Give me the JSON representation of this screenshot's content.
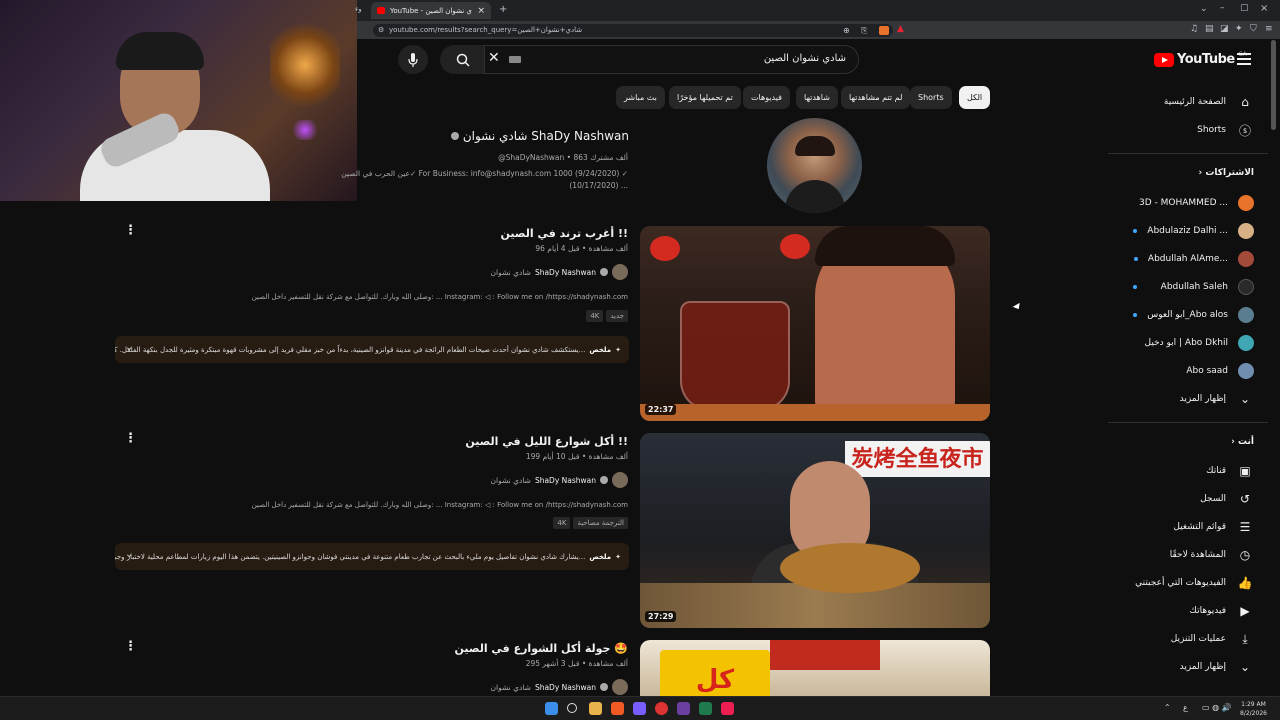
{
  "browser": {
    "tab_title": "YouTube - شادي نشوان الصين",
    "tab_side_label": "وء",
    "url": "youtube.com/results?search_query=شادي+نشوان+الصين",
    "new_tab": "+",
    "tab_close": "×",
    "window_controls": [
      "⌄",
      "–",
      "▢",
      "×"
    ]
  },
  "masthead": {
    "logo_text": "YouTube",
    "logo_country": "SA",
    "search_value": "شادي نشوان الصين"
  },
  "chips": [
    "الكل",
    "Shorts",
    "لم تتم مشاهدتها",
    "شاهدتها",
    "فيديوهات",
    "تم تحميلها مؤخرًا",
    "بث مباشر"
  ],
  "nav": {
    "home": "الصفحة الرئيسية",
    "shorts": "Shorts",
    "subscriptions_title": "الاشتراكات",
    "subscriptions": [
      {
        "name": "3D - MOHAMMED ...",
        "color": "#e8742c"
      },
      {
        "name": "Abdulaziz Dalhi ...",
        "color": "#d6b188"
      },
      {
        "name": "Abdullah AlAme...",
        "color": "#a34a3a"
      },
      {
        "name": "Abdullah Saleh",
        "color": "#2a2a2a"
      },
      {
        "name": "ابو العوس_Abo alos",
        "color": "#5a7d8f"
      },
      {
        "name": "ابو دخيل | Abo Dkhil",
        "color": "#3fa6b3"
      },
      {
        "name": "Abo saad",
        "color": "#6f8eb0"
      }
    ],
    "show_more": "إظهار المزيد",
    "you_title": "أنت",
    "you_items": [
      {
        "label": "قناتك",
        "icon": "channel-icon"
      },
      {
        "label": "السجل",
        "icon": "history-icon"
      },
      {
        "label": "قوائم التشغيل",
        "icon": "playlists-icon"
      },
      {
        "label": "المشاهدة لاحقًا",
        "icon": "watch-later-icon"
      },
      {
        "label": "الفيديوهات التي أعجبتني",
        "icon": "like-icon"
      },
      {
        "label": "فيديوهاتك",
        "icon": "your-videos-icon"
      },
      {
        "label": "عمليات التنزيل",
        "icon": "download-icon"
      }
    ],
    "show_more_2": "إظهار المزيد"
  },
  "channel": {
    "name": "شادي نشوان ShaDy Nashwan",
    "handle_subs": "@ShaDyNashwan • 863 ألف مشترك",
    "desc_line1": "عين الحرب في الصين✓ For Business: info@shadynash.com 1000 (9/24/2020) ✓",
    "desc_line2": "(10/17/2020) ..."
  },
  "videos": [
    {
      "title": "أغرب ترند في الصين !!",
      "meta": "96 ألف مشاهدة • قبل 4 أيام",
      "channel_ar": "شادي نشوان",
      "channel_en": "ShaDy Nashwan",
      "desc": "وصلى الله وبارك. للتواصل مع شركة نقل للتسفير داخل الصين: ... Instagram: ◁ : Follow me on /https://shadynash.com",
      "badges": [
        "جديد",
        "4K"
      ],
      "summary_label": "ملخص",
      "summary_text": "يستكشف شادي نشوان أحدث صيحات الطعام الرائجة في مدينة قوانزو الصينية، بدءاً من خبز مقلي فريد إلى مشروبات قهوة مبتكرة ومثيرة للجدل بنكهة الفلفل. كتحب...",
      "duration": "22:37"
    },
    {
      "title": "أكل شوارع الليل في الصين !!",
      "meta": "199 ألف مشاهدة • قبل 10 أيام",
      "channel_ar": "شادي نشوان",
      "channel_en": "ShaDy Nashwan",
      "desc": "وصلى الله وبارك. للتواصل مع شركة نقل للتسفير داخل الصين: ... Instagram: ◁ : Follow me on /https://shadynash.com",
      "badges": [
        "الترجمة مصاحبة",
        "4K"
      ],
      "summary_label": "ملخص",
      "summary_text": "يشارك شادي نشوان تفاصيل يوم مليء بالبحث عن تجارب طعام متنوعة في مدينتي فوشان وجوانزو الصينيتين. يتضمن هذا اليوم زيارات لمطاعم محلية لاختبار وجبا...",
      "duration": "27:29",
      "sign": "炭烤全鱼夜市"
    },
    {
      "title": "جولة أكل الشوارع في الصين 🤩",
      "meta": "295 ألف مشاهدة • قبل 3 أشهر",
      "channel_ar": "شادي نشوان",
      "channel_en": "ShaDy Nashwan",
      "thumb_text": "كل شيء"
    }
  ],
  "taskbar": {
    "time": "1:29 AM",
    "date": "8/2/2026",
    "lang": "ع"
  }
}
